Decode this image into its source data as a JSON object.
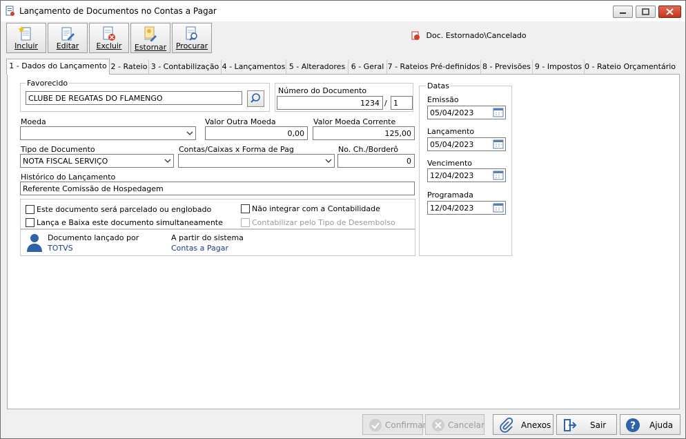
{
  "window": {
    "title": "Lançamento de Documentos no Contas a Pagar"
  },
  "toolbar": {
    "buttons": [
      {
        "label": "Incluir",
        "icon": "new-document-icon"
      },
      {
        "label": "Editar",
        "icon": "edit-document-icon"
      },
      {
        "label": "Excluir",
        "icon": "delete-document-icon"
      },
      {
        "label": "Estornar",
        "icon": "reverse-document-icon"
      },
      {
        "label": "Procurar",
        "icon": "search-document-icon"
      }
    ],
    "legend": "Doc. Estornado\\Cancelado"
  },
  "tabs": [
    "1 - Dados do Lançamento",
    "2 - Rateio",
    "3 - Contabilização",
    "4 - Lançamentos",
    "5 - Alteradores",
    "6 - Geral",
    "7 - Rateios Pré-definidos",
    "8 - Previsões",
    "9 - Impostos",
    "0 - Rateio Orçamentário"
  ],
  "form": {
    "favorecido_label": "Favorecido",
    "favorecido_value": "CLUBE DE REGATAS DO FLAMENGO",
    "numero_label": "Número do Documento",
    "numero_value": "1234",
    "numero_sep": "/",
    "numero_parcela": "1",
    "moeda_label": "Moeda",
    "moeda_value": "",
    "valor_outra_label": "Valor Outra Moeda",
    "valor_outra_value": "0,00",
    "valor_corrente_label": "Valor Moeda Corrente",
    "valor_corrente_value": "125,00",
    "tipo_doc_label": "Tipo de Documento",
    "tipo_doc_value": "NOTA FISCAL SERVIÇO",
    "contas_label": "Contas/Caixas x Forma de Pag",
    "contas_value": "",
    "no_ch_label": "No. Ch./Borderô",
    "no_ch_value": "0",
    "historico_label": "Histórico do Lançamento",
    "historico_value": "Referente Comissão de Hospedagem",
    "checkboxes": {
      "parcelado": "Este documento será parcelado ou englobado",
      "nao_integrar": "Não integrar com a Contabilidade",
      "lanca_baixa": "Lança e Baixa este documento simultaneamente",
      "contabilizar": "Contabilizar pelo Tipo de Desembolso"
    },
    "lancado_por_label": "Documento lançado por",
    "lancado_por_value": "TOTVS",
    "sistema_label": "A partir do sistema",
    "sistema_value": "Contas a Pagar"
  },
  "datas": {
    "group_label": "Datas",
    "emissao_label": "Emissão",
    "emissao_value": "05/04/2023",
    "lancamento_label": "Lançamento",
    "lancamento_value": "05/04/2023",
    "vencimento_label": "Vencimento",
    "vencimento_value": "12/04/2023",
    "programada_label": "Programada",
    "programada_value": "12/04/2023"
  },
  "bottom": {
    "confirmar": "Confirmar",
    "cancelar": "Cancelar",
    "anexos": "Anexos",
    "sair": "Sair",
    "ajuda": "Ajuda"
  }
}
